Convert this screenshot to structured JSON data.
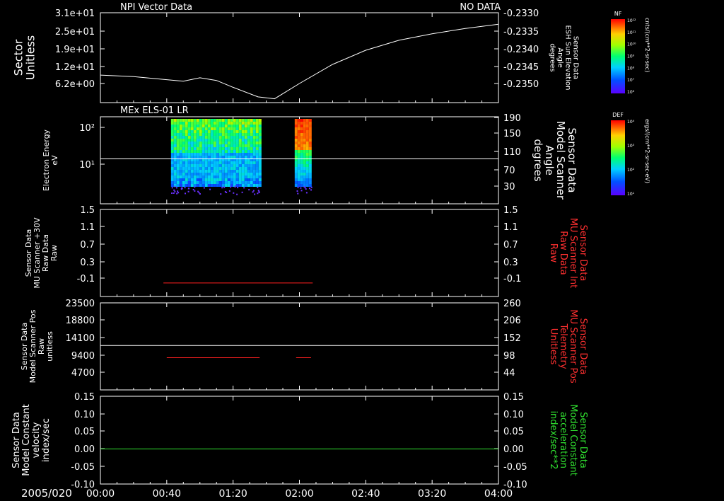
{
  "colors": {
    "bg": "#000000",
    "fg": "#ffffff",
    "red": "#ff2020",
    "green": "#30e030"
  },
  "time_axis": {
    "date_label": "2005/020",
    "ticks": [
      "00:00",
      "00:40",
      "01:20",
      "02:00",
      "02:40",
      "03:20",
      "04:00"
    ]
  },
  "chart_data": [
    {
      "type": "line",
      "panel_title": "NPI Vector Data",
      "status": "NO DATA",
      "ylabel_left": [
        "Sector",
        "Unitless"
      ],
      "left_ticks": [
        "3.1e+01",
        "2.5e+01",
        "1.9e+01",
        "1.2e+01",
        "6.2e+00"
      ],
      "ylabel_right": [
        "Sensor Data",
        "ESH Sun Elevation",
        "Angle",
        "degrees"
      ],
      "right_ticks": [
        "-0.2330",
        "-0.2335",
        "-0.2340",
        "-0.2345",
        "-0.2350"
      ],
      "right_ylim": [
        -0.23535,
        -0.233
      ],
      "colorbar": {
        "title": "NF",
        "units": "cnts/(cm**2-sr-sec)",
        "ticks": [
          "10¹²",
          "10¹¹",
          "10¹⁰",
          "10⁹",
          "10⁸",
          "10⁷",
          "10⁶"
        ]
      },
      "series": [
        {
          "x": [
            "00:00",
            "00:20",
            "00:40",
            "00:50",
            "01:00",
            "01:10",
            "01:20",
            "01:35",
            "01:45",
            "02:00",
            "02:20",
            "02:40",
            "03:00",
            "03:20",
            "03:40",
            "04:00"
          ],
          "values": [
            -0.23463,
            -0.23467,
            -0.23475,
            -0.23479,
            -0.2347,
            -0.23477,
            -0.23495,
            -0.2352,
            -0.23525,
            -0.23485,
            -0.23435,
            -0.23398,
            -0.23372,
            -0.23355,
            -0.23341,
            -0.2333
          ]
        }
      ]
    },
    {
      "type": "heatmap",
      "panel_title": "MEx ELS-01 LR",
      "ylabel_left": [
        "Electron Energy",
        "eV"
      ],
      "left_ticks": [
        "10²",
        "10¹"
      ],
      "ylabel_right": [
        "Sensor Data",
        "Model Scanner",
        "Angle",
        "degrees"
      ],
      "right_ticks": [
        "190",
        "150",
        "110",
        "70",
        "30"
      ],
      "right_ylim": [
        0,
        190
      ],
      "colorbar": {
        "title": "DEF",
        "units": "ergs/(cm**2-sr-sec-eV)",
        "ticks": [
          "10⁴",
          "10³",
          "10²",
          "10¹"
        ]
      },
      "data_intervals": [
        [
          "00:40",
          "01:36"
        ],
        [
          "01:58",
          "02:07"
        ]
      ],
      "series": [
        {
          "x": [
            "00:00",
            "04:00"
          ],
          "values": [
            98,
            98
          ]
        }
      ]
    },
    {
      "type": "line",
      "ylabel_left": [
        "Sensor Data",
        "MU Scanner +30V",
        "Raw Data",
        "Raw"
      ],
      "left_ticks": [
        "1.5",
        "1.1",
        "0.7",
        "0.3",
        "-0.1"
      ],
      "ylabel_right": [
        "Sensor Data",
        "MU Scanner Int",
        "Raw Data",
        "Raw"
      ],
      "right_ticks": [
        "1.5",
        "1.1",
        "0.7",
        "0.3",
        "-0.1"
      ],
      "ylim": [
        -0.3,
        1.5
      ],
      "series": [
        {
          "x": [
            "00:38",
            "02:08"
          ],
          "values": [
            -0.02,
            -0.02
          ]
        }
      ]
    },
    {
      "type": "line",
      "ylabel_left": [
        "Sensor Data",
        "Model Scanner Pos",
        "Raw",
        "unitless"
      ],
      "left_ticks": [
        "23500",
        "18800",
        "14100",
        "9400",
        "4700"
      ],
      "ylabel_right": [
        "Sensor Data",
        "MU Scanner Pos",
        "Telemetry",
        "Unitless"
      ],
      "right_ticks": [
        "260",
        "206",
        "152",
        "98",
        "44"
      ],
      "ylim": [
        0,
        23500
      ],
      "right_ylim": [
        0,
        260
      ],
      "series": [
        {
          "name": "white",
          "x": [
            "00:00",
            "04:00"
          ],
          "values": [
            12000,
            12000
          ]
        },
        {
          "name": "red-1",
          "x": [
            "00:40",
            "01:36"
          ],
          "values": [
            8700,
            8700
          ]
        },
        {
          "name": "red-2",
          "x": [
            "01:58",
            "02:07"
          ],
          "values": [
            8700,
            8700
          ]
        }
      ]
    },
    {
      "type": "line",
      "ylabel_left": [
        "Sensor Data",
        "Model Constant",
        "velocity",
        "index/sec"
      ],
      "left_ticks": [
        "0.15",
        "0.10",
        "0.05",
        "0.00",
        "-0.05",
        "-0.10"
      ],
      "ylabel_right": [
        "Sensor Data",
        "Model Constant",
        "acceleration",
        "index/sec**2"
      ],
      "right_ticks": [
        "0.15",
        "0.10",
        "0.05",
        "0.00",
        "-0.05",
        "-0.10"
      ],
      "ylim": [
        -0.1,
        0.15
      ],
      "series": [
        {
          "x": [
            "00:00",
            "04:00"
          ],
          "values": [
            0.0,
            0.0
          ]
        }
      ]
    }
  ]
}
